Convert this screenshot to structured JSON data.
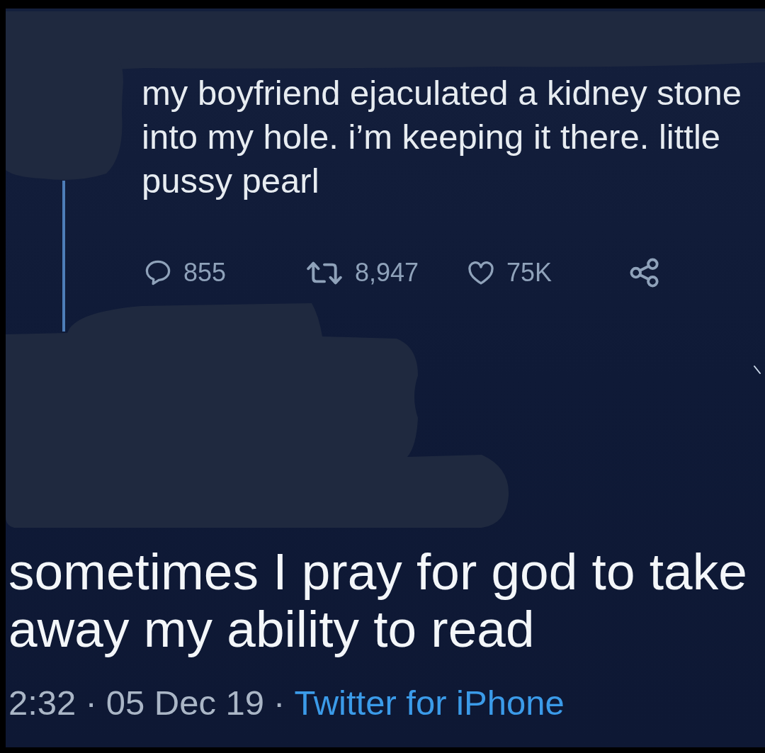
{
  "thread_tweet": {
    "text": "my boyfriend ejaculated a kidney stone into my hole. i’m keeping it there. little pussy pearl",
    "actions": [
      {
        "kind": "reply",
        "count": "855"
      },
      {
        "kind": "retweet",
        "count": "8,947"
      },
      {
        "kind": "like",
        "count": "75K"
      },
      {
        "kind": "share"
      }
    ]
  },
  "reply_tweet": {
    "text": "sometimes I pray for god to take away my ability to read",
    "meta": [
      {
        "kind": "time",
        "text": "2:32"
      },
      {
        "kind": "separator",
        "text": "·"
      },
      {
        "kind": "date",
        "text": "05 Dec 19"
      },
      {
        "kind": "separator",
        "text": "·"
      },
      {
        "kind": "source",
        "text": "Twitter for iPhone"
      }
    ]
  }
}
